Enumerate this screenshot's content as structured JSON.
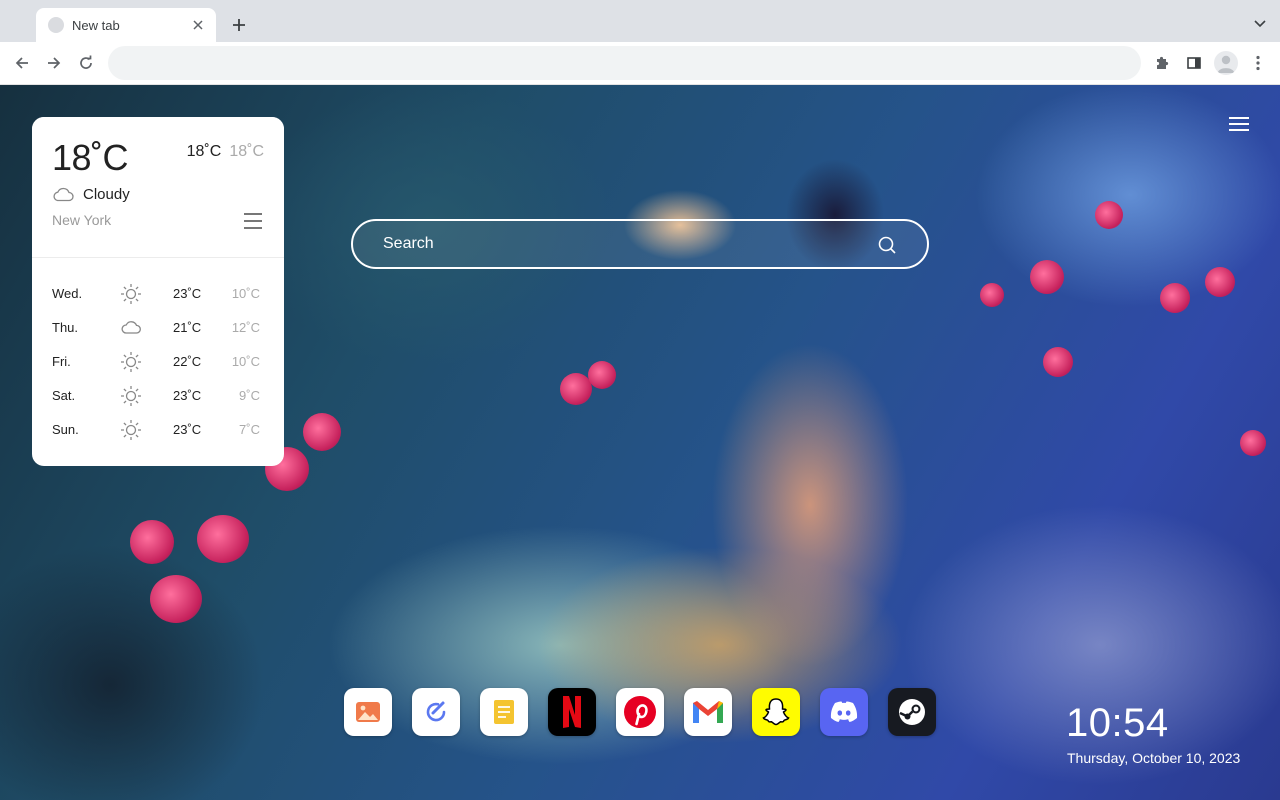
{
  "browser": {
    "tab_title": "New tab",
    "address_value": "",
    "icons": {
      "new_tab": "plus-icon",
      "tab_search": "chevron-down-icon",
      "back": "arrow-left-icon",
      "forward": "arrow-right-icon",
      "reload": "reload-icon",
      "extensions": "puzzle-icon",
      "side_panel": "side-panel-icon",
      "profile": "profile-icon",
      "menu": "kebab-menu-icon"
    }
  },
  "weather": {
    "current_temp": "18˚C",
    "high": "18˚C",
    "low": "18˚C",
    "condition": "Cloudy",
    "condition_icon": "cloud-icon",
    "city": "New York",
    "forecast": [
      {
        "day": "Wed.",
        "icon": "sun-icon",
        "high": "23˚C",
        "low": "10˚C"
      },
      {
        "day": "Thu.",
        "icon": "cloud-icon",
        "high": "21˚C",
        "low": "12˚C"
      },
      {
        "day": "Fri.",
        "icon": "sun-icon",
        "high": "22˚C",
        "low": "10˚C"
      },
      {
        "day": "Sat.",
        "icon": "sun-icon",
        "high": "23˚C",
        "low": "9˚C"
      },
      {
        "day": "Sun.",
        "icon": "sun-icon",
        "high": "23˚C",
        "low": "7˚C"
      }
    ]
  },
  "search": {
    "placeholder": "Search",
    "icon": "search-icon"
  },
  "dock": {
    "apps": [
      {
        "name": "Photos",
        "icon": "image-icon",
        "bg": "#ffffff"
      },
      {
        "name": "Tasks",
        "icon": "check-pencil-icon",
        "bg": "#ffffff"
      },
      {
        "name": "Notes",
        "icon": "note-icon",
        "bg": "#ffffff"
      },
      {
        "name": "Netflix",
        "icon": "netflix-icon",
        "bg": "#000000"
      },
      {
        "name": "Pinterest",
        "icon": "pinterest-icon",
        "bg": "#ffffff"
      },
      {
        "name": "Gmail",
        "icon": "gmail-icon",
        "bg": "#ffffff"
      },
      {
        "name": "Snapchat",
        "icon": "snapchat-icon",
        "bg": "#fffc00"
      },
      {
        "name": "Discord",
        "icon": "discord-icon",
        "bg": "#5865f2"
      },
      {
        "name": "Steam",
        "icon": "steam-icon",
        "bg": "#171a21"
      }
    ]
  },
  "clock": {
    "time": "10:54",
    "date": "Thursday, October 10, 2023"
  },
  "colors": {
    "chrome_bg": "#dee1e6",
    "omnibox_bg": "#f1f3f4",
    "netflix_red": "#e50914",
    "pinterest_red": "#e60023",
    "discord_blue": "#5865f2"
  }
}
